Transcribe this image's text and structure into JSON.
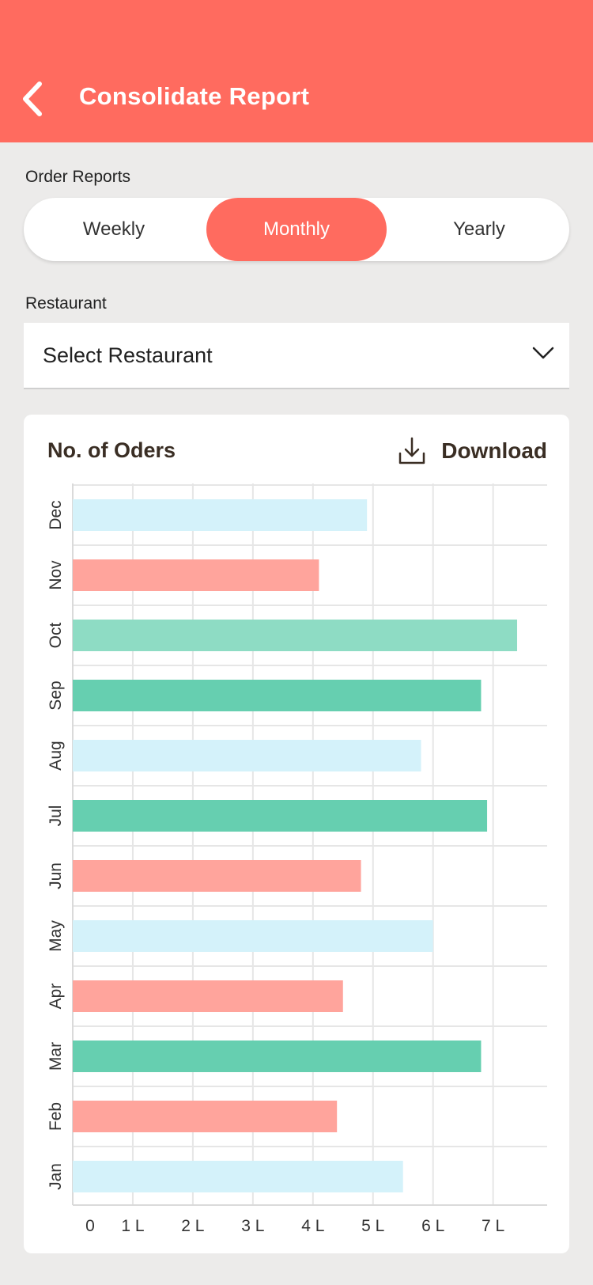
{
  "header": {
    "title": "Consolidate Report",
    "back_icon": "chevron-left-icon",
    "bg_color": "#FF6B5F"
  },
  "order_reports": {
    "label": "Order Reports",
    "options": [
      "Weekly",
      "Monthly",
      "Yearly"
    ],
    "selected": "Monthly"
  },
  "restaurant": {
    "label": "Restaurant",
    "value": "Select Restaurant",
    "icon": "chevron-down-icon"
  },
  "card": {
    "title": "No. of Oders",
    "download_label": "Download",
    "download_icon": "download-icon"
  },
  "chart_data": {
    "type": "bar",
    "orientation": "horizontal",
    "title": "No. of Oders",
    "categories": [
      "Jan",
      "Feb",
      "Mar",
      "Apr",
      "May",
      "Jun",
      "Jul",
      "Aug",
      "Sep",
      "Oct",
      "Nov",
      "Dec"
    ],
    "values": [
      5.5,
      4.4,
      6.8,
      4.5,
      6.0,
      4.8,
      6.9,
      5.8,
      6.8,
      7.4,
      4.1,
      4.9
    ],
    "bar_colors": [
      "#D4F2FA",
      "#FFA49C",
      "#66CFB0",
      "#FFA49C",
      "#D4F2FA",
      "#FFA49C",
      "#66CFB0",
      "#D4F2FA",
      "#66CFB0",
      "#8EDCC4",
      "#FFA49C",
      "#D4F2FA"
    ],
    "x_ticks": [
      "0",
      "1 L",
      "2 L",
      "3 L",
      "4 L",
      "5 L",
      "6 L",
      "7 L"
    ],
    "xlim": [
      0,
      7.9
    ],
    "grid": true
  }
}
